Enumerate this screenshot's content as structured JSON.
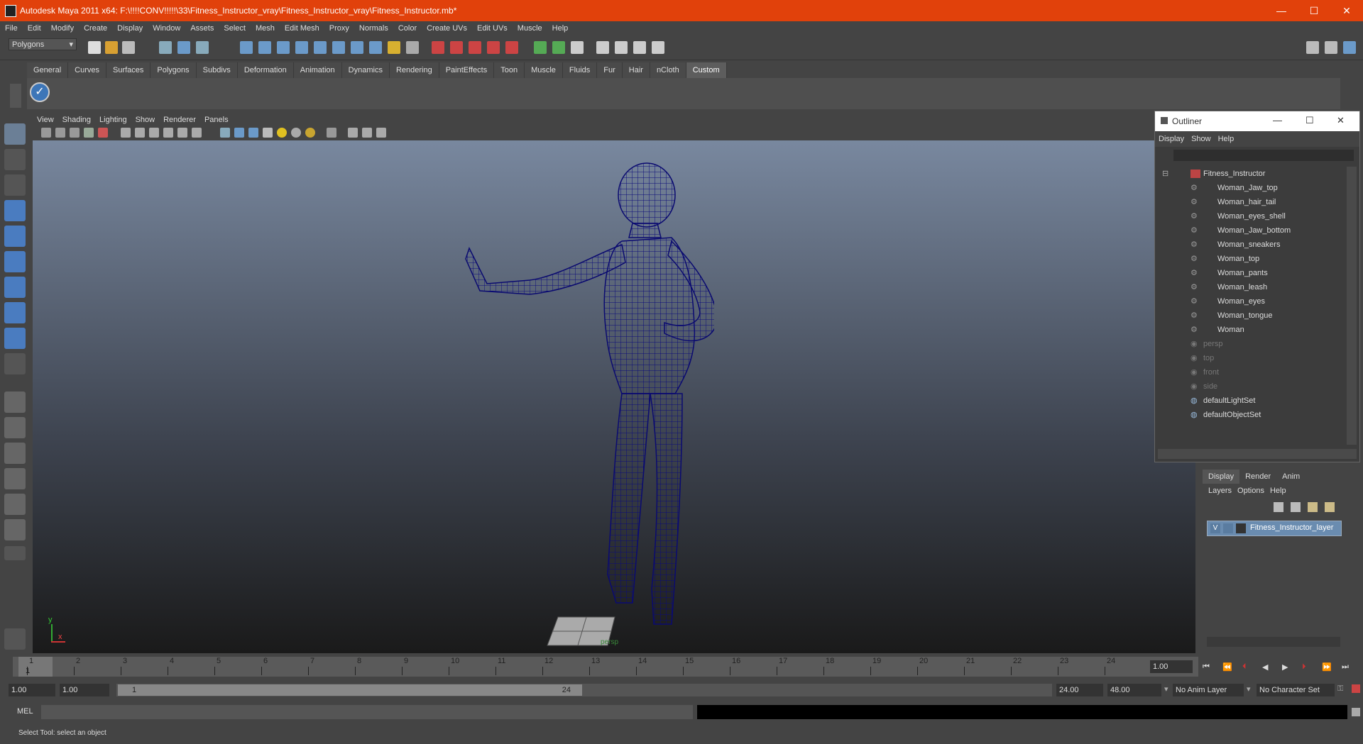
{
  "window": {
    "title": "Autodesk Maya 2011 x64: F:\\!!!!CONV!!!!!\\33\\Fitness_Instructor_vray\\Fitness_Instructor_vray\\Fitness_Instructor.mb*",
    "minimize": "—",
    "maximize": "☐",
    "close": "✕"
  },
  "menubar": [
    "File",
    "Edit",
    "Modify",
    "Create",
    "Display",
    "Window",
    "Assets",
    "Select",
    "Mesh",
    "Edit Mesh",
    "Proxy",
    "Normals",
    "Color",
    "Create UVs",
    "Edit UVs",
    "Muscle",
    "Help"
  ],
  "mode_selector": "Polygons",
  "shelf_tabs": [
    "General",
    "Curves",
    "Surfaces",
    "Polygons",
    "Subdivs",
    "Deformation",
    "Animation",
    "Dynamics",
    "Rendering",
    "PaintEffects",
    "Toon",
    "Muscle",
    "Fluids",
    "Fur",
    "Hair",
    "nCloth",
    "Custom"
  ],
  "active_shelf_tab": "Custom",
  "viewport": {
    "menu": [
      "View",
      "Shading",
      "Lighting",
      "Show",
      "Renderer",
      "Panels"
    ],
    "camera_label": "persp",
    "axis_y": "y",
    "axis_x": "x"
  },
  "outliner": {
    "title": "Outliner",
    "menu": [
      "Display",
      "Show",
      "Help"
    ],
    "items": [
      {
        "label": "Fitness_Instructor",
        "level": 0,
        "dim": false
      },
      {
        "label": "Woman_Jaw_top",
        "level": 1,
        "dim": false
      },
      {
        "label": "Woman_hair_tail",
        "level": 1,
        "dim": false
      },
      {
        "label": "Woman_eyes_shell",
        "level": 1,
        "dim": false
      },
      {
        "label": "Woman_Jaw_bottom",
        "level": 1,
        "dim": false
      },
      {
        "label": "Woman_sneakers",
        "level": 1,
        "dim": false
      },
      {
        "label": "Woman_top",
        "level": 1,
        "dim": false
      },
      {
        "label": "Woman_pants",
        "level": 1,
        "dim": false
      },
      {
        "label": "Woman_leash",
        "level": 1,
        "dim": false
      },
      {
        "label": "Woman_eyes",
        "level": 1,
        "dim": false
      },
      {
        "label": "Woman_tongue",
        "level": 1,
        "dim": false
      },
      {
        "label": "Woman",
        "level": 1,
        "dim": false
      },
      {
        "label": "persp",
        "level": 0,
        "dim": true
      },
      {
        "label": "top",
        "level": 0,
        "dim": true
      },
      {
        "label": "front",
        "level": 0,
        "dim": true
      },
      {
        "label": "side",
        "level": 0,
        "dim": true
      },
      {
        "label": "defaultLightSet",
        "level": 0,
        "dim": false
      },
      {
        "label": "defaultObjectSet",
        "level": 0,
        "dim": false
      }
    ]
  },
  "layer_editor": {
    "tabs": [
      "Display",
      "Render",
      "Anim"
    ],
    "menu": [
      "Layers",
      "Options",
      "Help"
    ],
    "layer": {
      "visible": "V",
      "name": "Fitness_Instructor_layer"
    }
  },
  "timeline": {
    "ticks": [
      "1",
      "2",
      "3",
      "4",
      "5",
      "6",
      "7",
      "8",
      "9",
      "10",
      "11",
      "12",
      "13",
      "14",
      "15",
      "16",
      "17",
      "18",
      "19",
      "20",
      "21",
      "22",
      "23",
      "24"
    ],
    "current_frame": "1",
    "current_field": "1.00"
  },
  "range": {
    "start": "1.00",
    "playback_start": "1.00",
    "slider_min": "1",
    "slider_max": "24",
    "playback_end": "24.00",
    "end": "48.00",
    "anim_layer": "No Anim Layer",
    "character_set": "No Character Set"
  },
  "command_line": {
    "label": "MEL"
  },
  "help_line": "Select Tool: select an object"
}
